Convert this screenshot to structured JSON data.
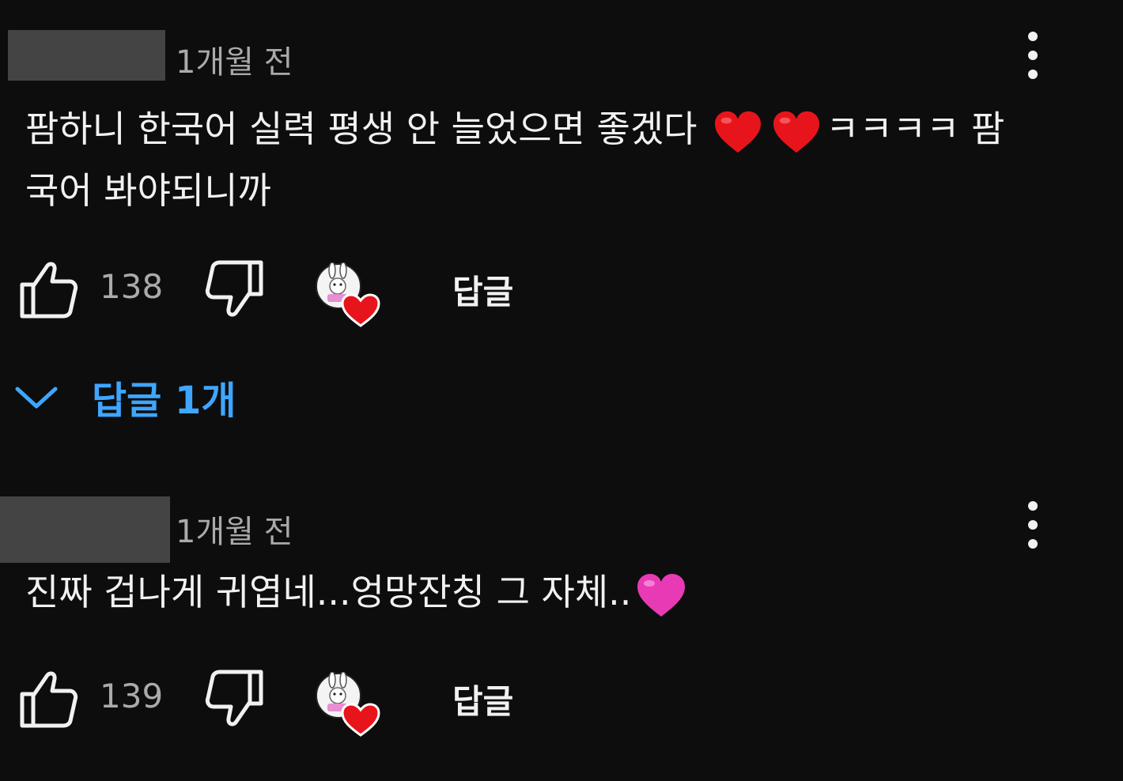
{
  "comments": [
    {
      "time": "1개월 전",
      "lines": [
        {
          "before": "팜하니 한국어 실력 평생 안 늘었으면 좋겠다 ",
          "after": "ㅋㅋㅋㅋ 팜"
        },
        {
          "text": "국어 봐야되니까"
        }
      ],
      "likes": "138",
      "reply_label": "답글",
      "replies_label": "답글 1개"
    },
    {
      "time": "1개월 전",
      "text": "진짜 겁나게 귀엽네...엉망잔칭 그 자체..",
      "likes": "139",
      "reply_label": "답글"
    }
  ],
  "colors": {
    "background": "#0d0d0d",
    "text": "#f1f1f1",
    "muted": "#aaaaaa",
    "link": "#3ea6ff",
    "heart_red": "#e8141c",
    "heart_pink": "#e83ab5"
  },
  "icons": {
    "menu": "vertical-dots-icon",
    "like": "thumbs-up-icon",
    "dislike": "thumbs-down-icon",
    "creator": "creator-heart-icon",
    "expand": "chevron-down-icon"
  }
}
